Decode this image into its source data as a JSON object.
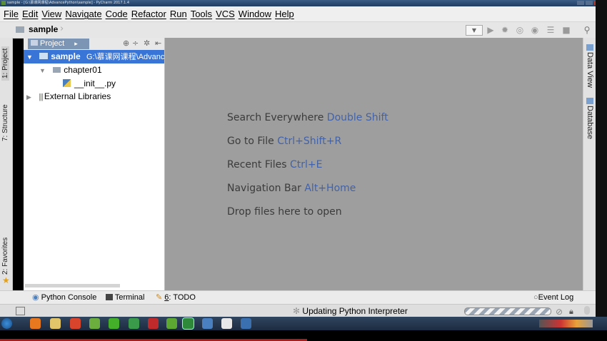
{
  "window": {
    "title": "sample - [G:\\慕课网课程\\AdvancePython\\sample] - PyCharm 2017.1.4"
  },
  "menu": [
    "File",
    "Edit",
    "View",
    "Navigate",
    "Code",
    "Refactor",
    "Run",
    "Tools",
    "VCS",
    "Window",
    "Help"
  ],
  "navbar": {
    "breadcrumb": "sample",
    "combo_icon": "chevron-down-icon"
  },
  "left_stripe": {
    "project": "1: Project",
    "structure": "7: Structure",
    "favorites": "2: Favorites"
  },
  "right_stripe": {
    "data_view": "Data View",
    "database": "Database"
  },
  "project_panel": {
    "tab": "Project",
    "tree": [
      {
        "label": "sample",
        "path": "G:\\慕课网课程\\Advanc",
        "level": 0,
        "selected": true,
        "expanded": true,
        "icon": "folder-icon"
      },
      {
        "label": "chapter01",
        "level": 1,
        "expanded": true,
        "icon": "package-folder-icon"
      },
      {
        "label": "__init__.py",
        "level": 2,
        "icon": "python-file-icon"
      },
      {
        "label": "External Libraries",
        "level": 0,
        "expanded": false,
        "icon": "library-icon"
      }
    ]
  },
  "editor_hints": [
    {
      "text": "Search Everywhere",
      "key": "Double Shift"
    },
    {
      "text": "Go to File",
      "key": "Ctrl+Shift+R"
    },
    {
      "text": "Recent Files",
      "key": "Ctrl+E"
    },
    {
      "text": "Navigation Bar",
      "key": "Alt+Home"
    },
    {
      "text": "Drop files here to open",
      "key": ""
    }
  ],
  "bottom_tools": {
    "python_console": "Python Console",
    "terminal": "Terminal",
    "todo_num": "6",
    "todo": ": TODO",
    "event_log": "Event Log"
  },
  "status": {
    "message": "Updating Python Interpreter"
  },
  "colors": {
    "selection": "#3875d7",
    "shortcut": "#4262a8",
    "editor_bg": "#9e9e9e"
  }
}
